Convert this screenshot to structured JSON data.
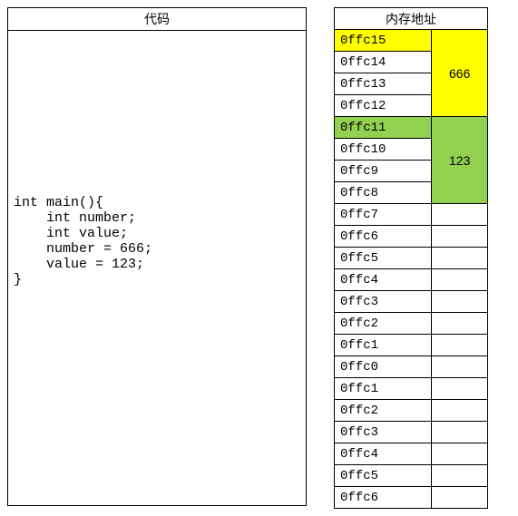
{
  "code_panel": {
    "header": "代码",
    "lines": [
      "int main(){",
      "    int number;",
      "    int value;",
      "    number = 666;",
      "    value = 123;",
      "}"
    ]
  },
  "memory_panel": {
    "header": "内存地址",
    "groups": [
      {
        "value": "666",
        "colorClass": "bg-yellow",
        "cells": [
          "0ffc15",
          "0ffc14",
          "0ffc13",
          "0ffc12"
        ],
        "highlightCell": "0ffc15"
      },
      {
        "value": "123",
        "colorClass": "bg-green",
        "cells": [
          "0ffc11",
          "0ffc10",
          "0ffc9",
          "0ffc8"
        ],
        "highlightCell": "0ffc11"
      }
    ],
    "rest": [
      "0ffc7",
      "0ffc6",
      "0ffc5",
      "0ffc4",
      "0ffc3",
      "0ffc2",
      "0ffc1",
      "0ffc0",
      "0ffc1",
      "0ffc2",
      "0ffc3",
      "0ffc4",
      "0ffc5",
      "0ffc6"
    ]
  }
}
